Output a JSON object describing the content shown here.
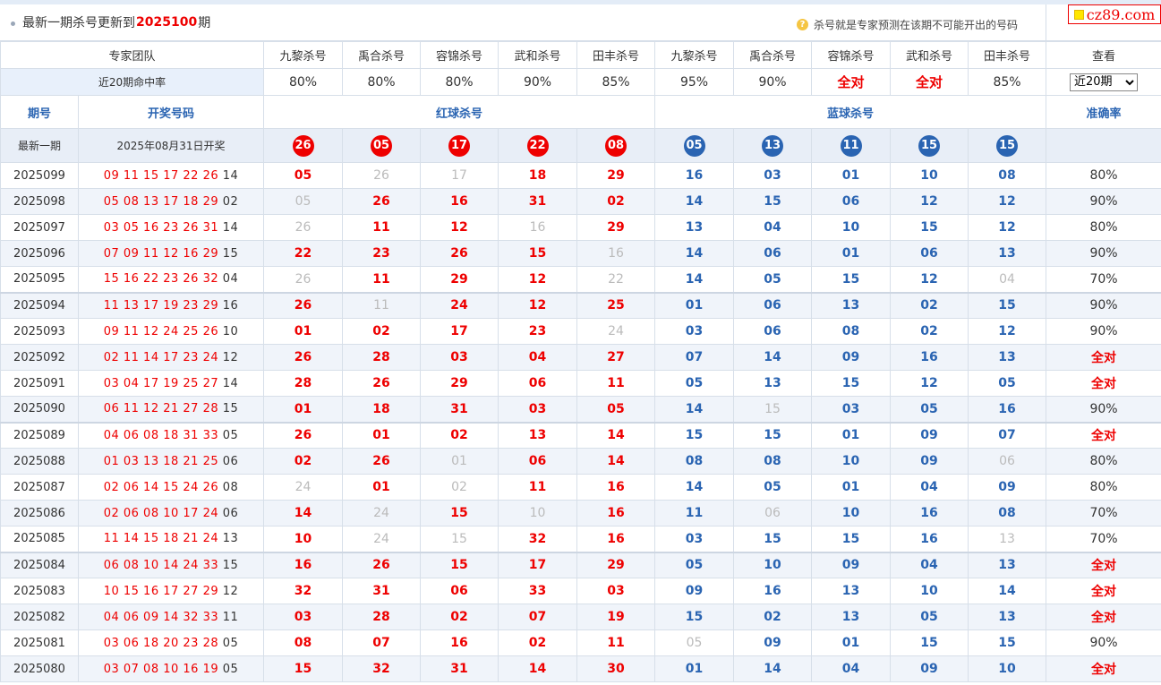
{
  "header": {
    "title_prefix": "最新一期杀号更新到",
    "latest_issue": "2025100",
    "title_suffix": "期",
    "note_icon": "question-icon",
    "note": "杀号就是专家预测在该期不可能开出的号码",
    "logo": "cz89.com"
  },
  "team_row": {
    "label": "专家团队",
    "experts": [
      "九黎杀号",
      "禹合杀号",
      "容锦杀号",
      "武和杀号",
      "田丰杀号",
      "九黎杀号",
      "禹合杀号",
      "容锦杀号",
      "武和杀号",
      "田丰杀号"
    ],
    "view_label": "查看"
  },
  "rate_row": {
    "label": "近20期命中率",
    "rates": [
      "80%",
      "80%",
      "80%",
      "90%",
      "85%",
      "95%",
      "90%",
      "全对",
      "全对",
      "85%"
    ],
    "select_value": "近20期"
  },
  "section_row": {
    "period": "期号",
    "draw": "开奖号码",
    "red": "红球杀号",
    "blue": "蓝球杀号",
    "accuracy": "准确率"
  },
  "latest_row": {
    "label": "最新一期",
    "date": "2025年08月31日开奖",
    "red": [
      "26",
      "05",
      "17",
      "22",
      "08"
    ],
    "blue": [
      "05",
      "13",
      "11",
      "15",
      "15"
    ]
  },
  "rows": [
    {
      "period": "2025099",
      "reds": "09 11 15 17 22 26",
      "blue": "14",
      "kill_red": [
        "05",
        "26",
        "17",
        "18",
        "29"
      ],
      "kill_blue": [
        "16",
        "03",
        "01",
        "10",
        "08"
      ],
      "acc": "80%"
    },
    {
      "period": "2025098",
      "reds": "05 08 13 17 18 29",
      "blue": "02",
      "kill_red": [
        "05",
        "26",
        "16",
        "31",
        "02"
      ],
      "kill_blue": [
        "14",
        "15",
        "06",
        "12",
        "12"
      ],
      "acc": "90%"
    },
    {
      "period": "2025097",
      "reds": "03 05 16 23 26 31",
      "blue": "14",
      "kill_red": [
        "26",
        "11",
        "12",
        "16",
        "29"
      ],
      "kill_blue": [
        "13",
        "04",
        "10",
        "15",
        "12"
      ],
      "acc": "80%"
    },
    {
      "period": "2025096",
      "reds": "07 09 11 12 16 29",
      "blue": "15",
      "kill_red": [
        "22",
        "23",
        "26",
        "15",
        "16"
      ],
      "kill_blue": [
        "14",
        "06",
        "01",
        "06",
        "13"
      ],
      "acc": "90%"
    },
    {
      "period": "2025095",
      "reds": "15 16 22 23 26 32",
      "blue": "04",
      "kill_red": [
        "26",
        "11",
        "29",
        "12",
        "22"
      ],
      "kill_blue": [
        "14",
        "05",
        "15",
        "12",
        "04"
      ],
      "acc": "70%"
    },
    {
      "period": "2025094",
      "reds": "11 13 17 19 23 29",
      "blue": "16",
      "kill_red": [
        "26",
        "11",
        "24",
        "12",
        "25"
      ],
      "kill_blue": [
        "01",
        "06",
        "13",
        "02",
        "15"
      ],
      "acc": "90%"
    },
    {
      "period": "2025093",
      "reds": "09 11 12 24 25 26",
      "blue": "10",
      "kill_red": [
        "01",
        "02",
        "17",
        "23",
        "24"
      ],
      "kill_blue": [
        "03",
        "06",
        "08",
        "02",
        "12"
      ],
      "acc": "90%"
    },
    {
      "period": "2025092",
      "reds": "02 11 14 17 23 24",
      "blue": "12",
      "kill_red": [
        "26",
        "28",
        "03",
        "04",
        "27"
      ],
      "kill_blue": [
        "07",
        "14",
        "09",
        "16",
        "13"
      ],
      "acc": "全对"
    },
    {
      "period": "2025091",
      "reds": "03 04 17 19 25 27",
      "blue": "14",
      "kill_red": [
        "28",
        "26",
        "29",
        "06",
        "11"
      ],
      "kill_blue": [
        "05",
        "13",
        "15",
        "12",
        "05"
      ],
      "acc": "全对"
    },
    {
      "period": "2025090",
      "reds": "06 11 12 21 27 28",
      "blue": "15",
      "kill_red": [
        "01",
        "18",
        "31",
        "03",
        "05"
      ],
      "kill_blue": [
        "14",
        "15",
        "03",
        "05",
        "16"
      ],
      "acc": "90%"
    },
    {
      "period": "2025089",
      "reds": "04 06 08 18 31 33",
      "blue": "05",
      "kill_red": [
        "26",
        "01",
        "02",
        "13",
        "14"
      ],
      "kill_blue": [
        "15",
        "15",
        "01",
        "09",
        "07"
      ],
      "acc": "全对"
    },
    {
      "period": "2025088",
      "reds": "01 03 13 18 21 25",
      "blue": "06",
      "kill_red": [
        "02",
        "26",
        "01",
        "06",
        "14"
      ],
      "kill_blue": [
        "08",
        "08",
        "10",
        "09",
        "06"
      ],
      "acc": "80%"
    },
    {
      "period": "2025087",
      "reds": "02 06 14 15 24 26",
      "blue": "08",
      "kill_red": [
        "24",
        "01",
        "02",
        "11",
        "16"
      ],
      "kill_blue": [
        "14",
        "05",
        "01",
        "04",
        "09"
      ],
      "acc": "80%"
    },
    {
      "period": "2025086",
      "reds": "02 06 08 10 17 24",
      "blue": "06",
      "kill_red": [
        "14",
        "24",
        "15",
        "10",
        "16"
      ],
      "kill_blue": [
        "11",
        "06",
        "10",
        "16",
        "08"
      ],
      "acc": "70%"
    },
    {
      "period": "2025085",
      "reds": "11 14 15 18 21 24",
      "blue": "13",
      "kill_red": [
        "10",
        "24",
        "15",
        "32",
        "16"
      ],
      "kill_blue": [
        "03",
        "15",
        "15",
        "16",
        "13"
      ],
      "acc": "70%"
    },
    {
      "period": "2025084",
      "reds": "06 08 10 14 24 33",
      "blue": "15",
      "kill_red": [
        "16",
        "26",
        "15",
        "17",
        "29"
      ],
      "kill_blue": [
        "05",
        "10",
        "09",
        "04",
        "13"
      ],
      "acc": "全对"
    },
    {
      "period": "2025083",
      "reds": "10 15 16 17 27 29",
      "blue": "12",
      "kill_red": [
        "32",
        "31",
        "06",
        "33",
        "03"
      ],
      "kill_blue": [
        "09",
        "16",
        "13",
        "10",
        "14"
      ],
      "acc": "全对"
    },
    {
      "period": "2025082",
      "reds": "04 06 09 14 32 33",
      "blue": "11",
      "kill_red": [
        "03",
        "28",
        "02",
        "07",
        "19"
      ],
      "kill_blue": [
        "15",
        "02",
        "13",
        "05",
        "13"
      ],
      "acc": "全对"
    },
    {
      "period": "2025081",
      "reds": "03 06 18 20 23 28",
      "blue": "05",
      "kill_red": [
        "08",
        "07",
        "16",
        "02",
        "11"
      ],
      "kill_blue": [
        "05",
        "09",
        "01",
        "15",
        "15"
      ],
      "acc": "90%"
    },
    {
      "period": "2025080",
      "reds": "03 07 08 10 16 19",
      "blue": "05",
      "kill_red": [
        "15",
        "32",
        "31",
        "14",
        "30"
      ],
      "kill_blue": [
        "01",
        "14",
        "04",
        "09",
        "10"
      ],
      "acc": "全对"
    }
  ]
}
